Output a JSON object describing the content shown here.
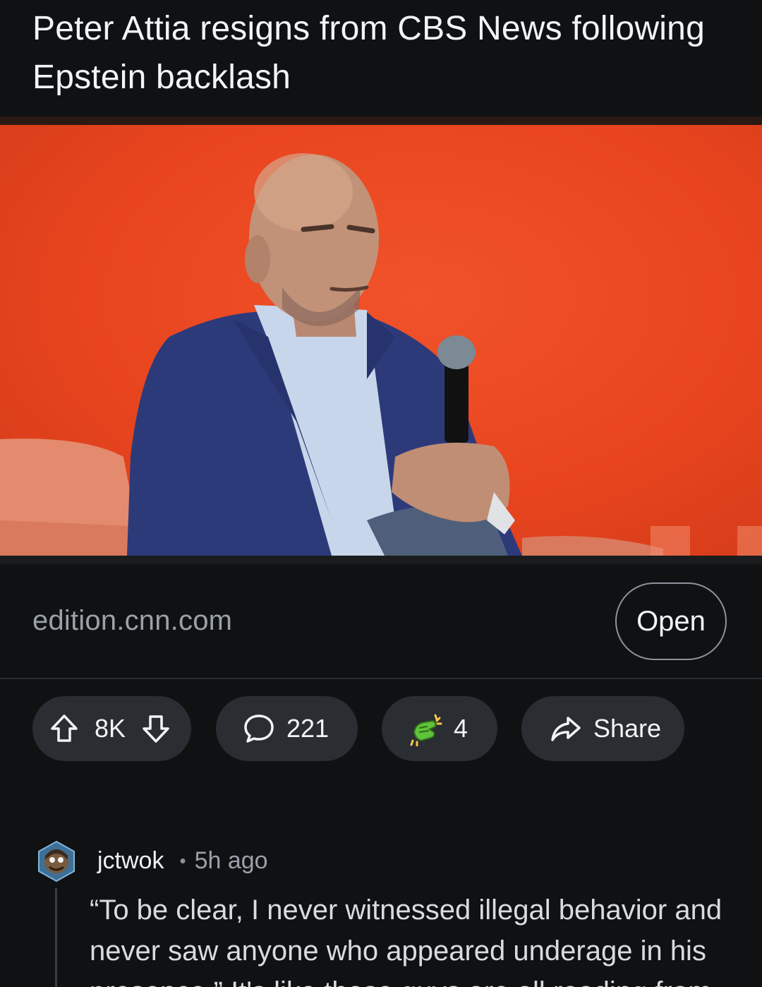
{
  "post": {
    "title": "Peter Attia resigns from CBS News following Epstein backlash",
    "source_domain": "edition.cnn.com",
    "open_label": "Open"
  },
  "actions": {
    "score": "8K",
    "comments": "221",
    "awards": "4",
    "share_label": "Share"
  },
  "comment": {
    "username": "jctwok",
    "separator": "•",
    "time": "5h ago",
    "text": "“To be clear, I never witnessed illegal behavior and never saw anyone who appeared underage in his presence.” It's like these guys are all reading from"
  },
  "icons": {
    "upvote": "arrow-up-icon",
    "downvote": "arrow-down-icon",
    "comment": "speech-bubble-icon",
    "award": "award-hand-icon",
    "share": "share-arrow-icon"
  },
  "colors": {
    "background": "#0f1113",
    "pill": "#2a2d31",
    "hero_orange": "#e8451f",
    "award_green": "#5ec23a"
  }
}
